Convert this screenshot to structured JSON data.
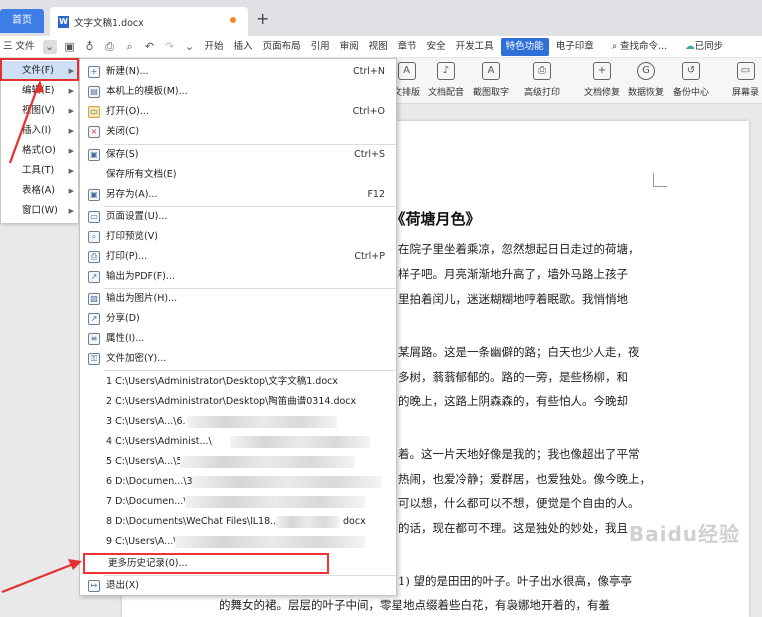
{
  "tabs": {
    "home": "首页",
    "document": "文字文稿1.docx",
    "new_tab": "+"
  },
  "menubar": {
    "file_menu": "三 文件",
    "items": [
      "开始",
      "插入",
      "页面布局",
      "引用",
      "审阅",
      "视图",
      "章节",
      "安全",
      "开发工具"
    ],
    "special": "特色功能",
    "after_special": "电子印章",
    "search": "查找命令...",
    "cloud": "已同步"
  },
  "ribbon": {
    "tools": [
      {
        "label": "文排版",
        "icon": "format-icon"
      },
      {
        "label": "文档配音",
        "icon": "mic-icon"
      },
      {
        "label": "截图取字",
        "icon": "screenshot-text-icon"
      },
      {
        "label": "高级打印",
        "icon": "print-icon"
      },
      {
        "label": "文档修复",
        "icon": "repair-icon"
      },
      {
        "label": "数据恢复",
        "icon": "recover-icon"
      },
      {
        "label": "备份中心",
        "icon": "backup-icon"
      },
      {
        "label": "屏幕录",
        "icon": "screen-record-icon"
      }
    ]
  },
  "left_menu": {
    "items": [
      {
        "label": "文件(F)",
        "active": true
      },
      {
        "label": "编辑(E)"
      },
      {
        "label": "视图(V)"
      },
      {
        "label": "插入(I)"
      },
      {
        "label": "格式(O)"
      },
      {
        "label": "工具(T)"
      },
      {
        "label": "表格(A)"
      },
      {
        "label": "窗口(W)"
      }
    ]
  },
  "file_submenu": {
    "items": [
      {
        "label": "新建(N)...",
        "shortcut": "Ctrl+N",
        "icon": "new-doc-icon"
      },
      {
        "label": "本机上的模板(M)...",
        "shortcut": "",
        "icon": "template-icon"
      },
      {
        "label": "打开(O)...",
        "shortcut": "Ctrl+O",
        "icon": "open-folder-icon"
      },
      {
        "label": "关闭(C)",
        "shortcut": "",
        "icon": "close-doc-icon"
      },
      {
        "label": "保存(S)",
        "shortcut": "Ctrl+S",
        "icon": "save-icon"
      },
      {
        "label": "保存所有文档(E)",
        "shortcut": "",
        "icon": ""
      },
      {
        "label": "另存为(A)...",
        "shortcut": "F12",
        "icon": "save-as-icon"
      },
      {
        "label": "页面设置(U)...",
        "shortcut": "",
        "icon": "page-setup-icon"
      },
      {
        "label": "打印预览(V)",
        "shortcut": "",
        "icon": "print-preview-icon"
      },
      {
        "label": "打印(P)...",
        "shortcut": "Ctrl+P",
        "icon": "print-icon"
      },
      {
        "label": "输出为PDF(F)...",
        "shortcut": "",
        "icon": "pdf-icon"
      },
      {
        "label": "输出为图片(H)...",
        "shortcut": "",
        "icon": "image-export-icon"
      },
      {
        "label": "分享(D)",
        "shortcut": "",
        "icon": "share-icon"
      },
      {
        "label": "属性(I)...",
        "shortcut": "",
        "icon": "properties-icon"
      },
      {
        "label": "文件加密(Y)...",
        "shortcut": "",
        "icon": "encrypt-icon"
      }
    ],
    "recent": [
      "1 C:\\Users\\Administrator\\Desktop\\文字文稿1.docx",
      "2 C:\\Users\\Administrator\\Desktop\\陶笛曲谱0314.docx",
      "3 C:\\Users\\A...\\6.",
      "4 C:\\Users\\Administ...\\",
      "5 C:\\Users\\A...\\5",
      "6 D:\\Documen...\\3.",
      "7 D:\\Documen...\\",
      "8 D:\\Documents\\WeChat Files\\lL18...",
      "9 C:\\Users\\A...\\"
    ],
    "recent_tail_8": "docx",
    "more_history": "更多历史记录(0)...",
    "exit": "退出(X)"
  },
  "document": {
    "title": "《荷塘月色》",
    "lines": [
      "在院子里坐着乘凉，忽然想起日日走过的荷塘，",
      "样子吧。月亮渐渐地升高了，墙外马路上孩子",
      "里拍着闰儿，迷迷糊糊地哼着眠歌。我悄悄地",
      "某屑路。这是一条幽僻的路；白天也少人走，夜",
      "多树，蓊蓊郁郁的。路的一旁，是些杨柳，和",
      "的晚上，这路上阴森森的，有些怕人。今晚却",
      "着。这一片天地好像是我的；我也像超出了平常",
      "热闹，也爱冷静；爱群居，也爱独处。像今晚上，",
      "可以想，什么都可以不想，便觉是个自由的人。",
      "的话，现在都可不理。这是独处的妙处，我且",
      "1) 望的是田田的叶子。叶子出水很高，像亭亭",
      "的舞女的裙。层层的叶子中间，零星地点缀着些白花，有袅娜地开着的，有羞"
    ]
  },
  "watermark": "Baidu经验",
  "annotation_color": "#e53030"
}
